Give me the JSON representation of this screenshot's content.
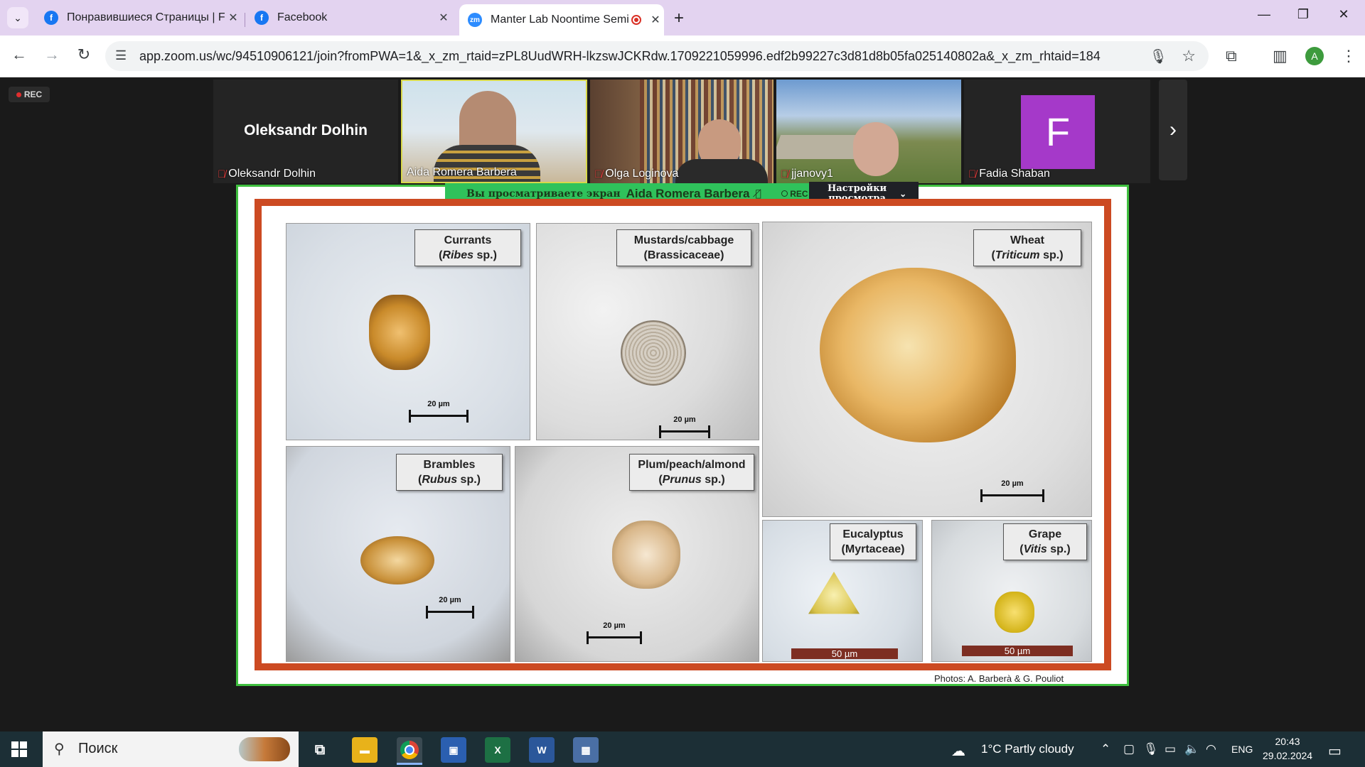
{
  "browser": {
    "tabs": [
      {
        "title": "Понравившиеся Страницы | Fa",
        "close": "✕"
      },
      {
        "title": "Facebook",
        "close": "✕"
      },
      {
        "title": "Manter Lab Noontime Semi",
        "close": "✕"
      }
    ],
    "new_tab": "+",
    "url": "app.zoom.us/wc/94510906121/join?fromPWA=1&_x_zm_rtaid=zPL8UudWRH-lkzswJCKRdw.1709221059996.edf2b99227c3d81d8b05fa025140802a&_x_zm_rhtaid=184",
    "profile_initial": "A",
    "zoom_favicon": "zm"
  },
  "zoom": {
    "rec_badge": "REC",
    "participants": [
      {
        "name": "Oleksandr Dolhin",
        "big_name": "Oleksandr Dolhin",
        "muted": true
      },
      {
        "name": "Aida Romera Barbera",
        "muted": false
      },
      {
        "name": "Olga Loginova",
        "muted": true
      },
      {
        "name": "jjanovy1",
        "muted": true
      },
      {
        "name": "Fadia Shaban",
        "muted": true,
        "avatar_letter": "F"
      }
    ],
    "next_arrow": "›",
    "share_banner": {
      "viewing": "Вы просматриваете экран",
      "presenter": "Aida Romera Barbera",
      "rec": "REC"
    },
    "view_options": {
      "line1": "Настройки",
      "line2": "просмотра",
      "chevron": "⌄"
    }
  },
  "slide": {
    "panels": [
      {
        "l1": "Currants",
        "l2a": "(",
        "l2i": "Ribes",
        "l2b": " sp.)",
        "scale": "20 µm"
      },
      {
        "l1": "Mustards/cabbage",
        "l2": "(Brassicaceae)",
        "scale": "20 µm"
      },
      {
        "l1": "Wheat",
        "l2a": "(",
        "l2i": "Triticum",
        "l2b": " sp.)",
        "scale": "20 µm"
      },
      {
        "l1": "Brambles",
        "l2a": "(",
        "l2i": "Rubus",
        "l2b": " sp.)",
        "scale": "20 µm"
      },
      {
        "l1": "Plum/peach/almond",
        "l2a": "(",
        "l2i": "Prunus",
        "l2b": " sp.)",
        "scale": "20 µm"
      },
      {
        "l1": "Eucalyptus",
        "l2": "(Myrtaceae)",
        "scale": "50 µm"
      },
      {
        "l1": "Grape",
        "l2a": "(",
        "l2i": "Vitis",
        "l2b": " sp.)",
        "scale": "50 µm"
      }
    ],
    "credit": "Photos: A. Barberà & G. Pouliot"
  },
  "taskbar": {
    "search_placeholder": "Поиск",
    "weather": "1°C  Partly cloudy",
    "lang": "ENG",
    "time": "20:43",
    "date": "29.02.2024"
  }
}
